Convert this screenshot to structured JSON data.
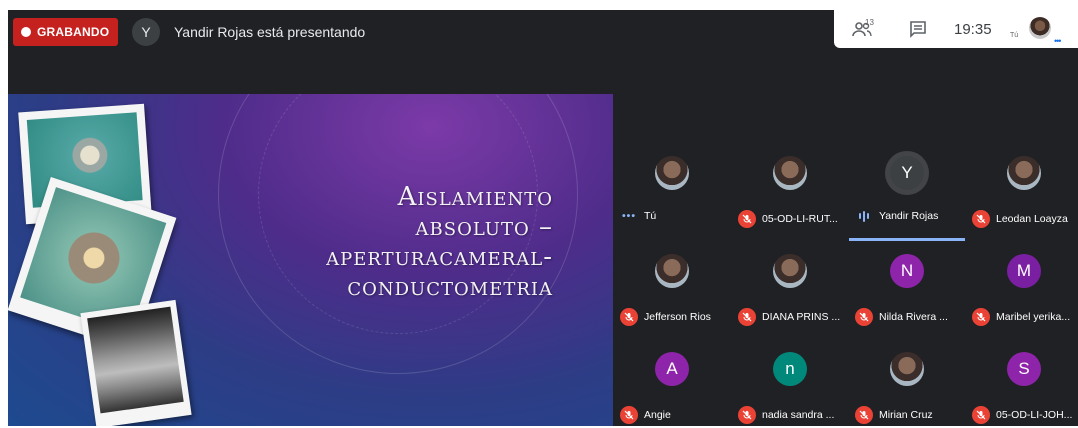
{
  "recording": {
    "label": "GRABANDO"
  },
  "presenter": {
    "initial": "Y",
    "text": "Yandir Rojas está presentando"
  },
  "tray": {
    "people_count": "13",
    "time": "19:35",
    "me_label": "Tú"
  },
  "slide": {
    "title_lines": [
      "Aislamiento",
      "absoluto –",
      "aperturacameral-",
      "conductometria"
    ]
  },
  "participants": [
    {
      "name": "Tú",
      "avatar": "",
      "avatar_color": "",
      "mic": "dots"
    },
    {
      "name": "05-OD-LI-RUT...",
      "avatar": "",
      "avatar_color": "",
      "mic": "off"
    },
    {
      "name": "Yandir Rojas",
      "avatar": "Y",
      "avatar_color": "#3c4043",
      "mic": "speaking"
    },
    {
      "name": "Leodan Loayza",
      "avatar": "",
      "avatar_color": "",
      "mic": "off"
    },
    {
      "name": "Jefferson Rios",
      "avatar": "",
      "avatar_color": "",
      "mic": "off"
    },
    {
      "name": "DIANA PRINS ...",
      "avatar": "",
      "avatar_color": "",
      "mic": "off"
    },
    {
      "name": "Nilda Rivera ...",
      "avatar": "N",
      "avatar_color": "#8e24aa",
      "mic": "off"
    },
    {
      "name": "Maribel yerika...",
      "avatar": "M",
      "avatar_color": "#7b1fa2",
      "mic": "off"
    },
    {
      "name": "Angie",
      "avatar": "A",
      "avatar_color": "#8e24aa",
      "mic": "off"
    },
    {
      "name": "nadia sandra ...",
      "avatar": "n",
      "avatar_color": "#00897b",
      "mic": "off"
    },
    {
      "name": "Mirian Cruz",
      "avatar": "",
      "avatar_color": "",
      "mic": "off"
    },
    {
      "name": "05-OD-LI-JOH...",
      "avatar": "S",
      "avatar_color": "#8e24aa",
      "mic": "off"
    }
  ]
}
